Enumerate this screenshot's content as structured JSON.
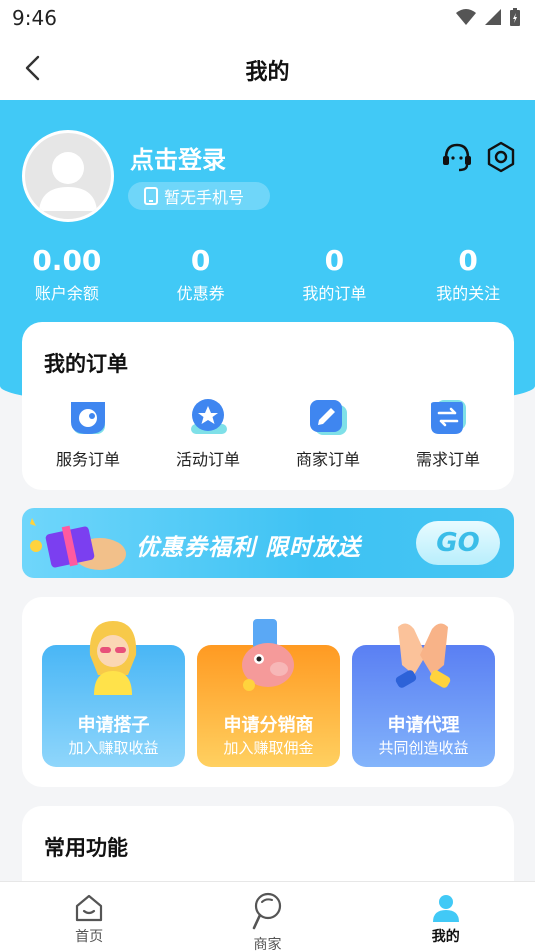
{
  "status_bar": {
    "time": "9:46"
  },
  "nav": {
    "title": "我的"
  },
  "profile": {
    "login_text": "点击登录",
    "phone_text": "暂无手机号"
  },
  "stats": [
    {
      "value": "0.00",
      "label": "账户余额"
    },
    {
      "value": "0",
      "label": "优惠券"
    },
    {
      "value": "0",
      "label": "我的订单"
    },
    {
      "value": "0",
      "label": "我的关注"
    }
  ],
  "orders": {
    "title": "我的订单",
    "items": [
      {
        "label": "服务订单",
        "icon": "service-order-icon"
      },
      {
        "label": "活动订单",
        "icon": "activity-order-icon"
      },
      {
        "label": "商家订单",
        "icon": "merchant-order-icon"
      },
      {
        "label": "需求订单",
        "icon": "demand-order-icon"
      }
    ]
  },
  "banner": {
    "text": "优惠券福利 限时放送",
    "go_label": "GO"
  },
  "apply": [
    {
      "title": "申请搭子",
      "subtitle": "加入赚取收益"
    },
    {
      "title": "申请分销商",
      "subtitle": "加入赚取佣金"
    },
    {
      "title": "申请代理",
      "subtitle": "共同创造收益"
    }
  ],
  "common": {
    "title": "常用功能"
  },
  "tabs": [
    {
      "label": "首页",
      "icon": "home-icon"
    },
    {
      "label": "商家",
      "icon": "merchant-icon"
    },
    {
      "label": "我的",
      "icon": "profile-icon"
    }
  ],
  "colors": {
    "primary": "#41c9f6",
    "orange": "#ffa22e",
    "blue_purple": "#5c86f3"
  }
}
